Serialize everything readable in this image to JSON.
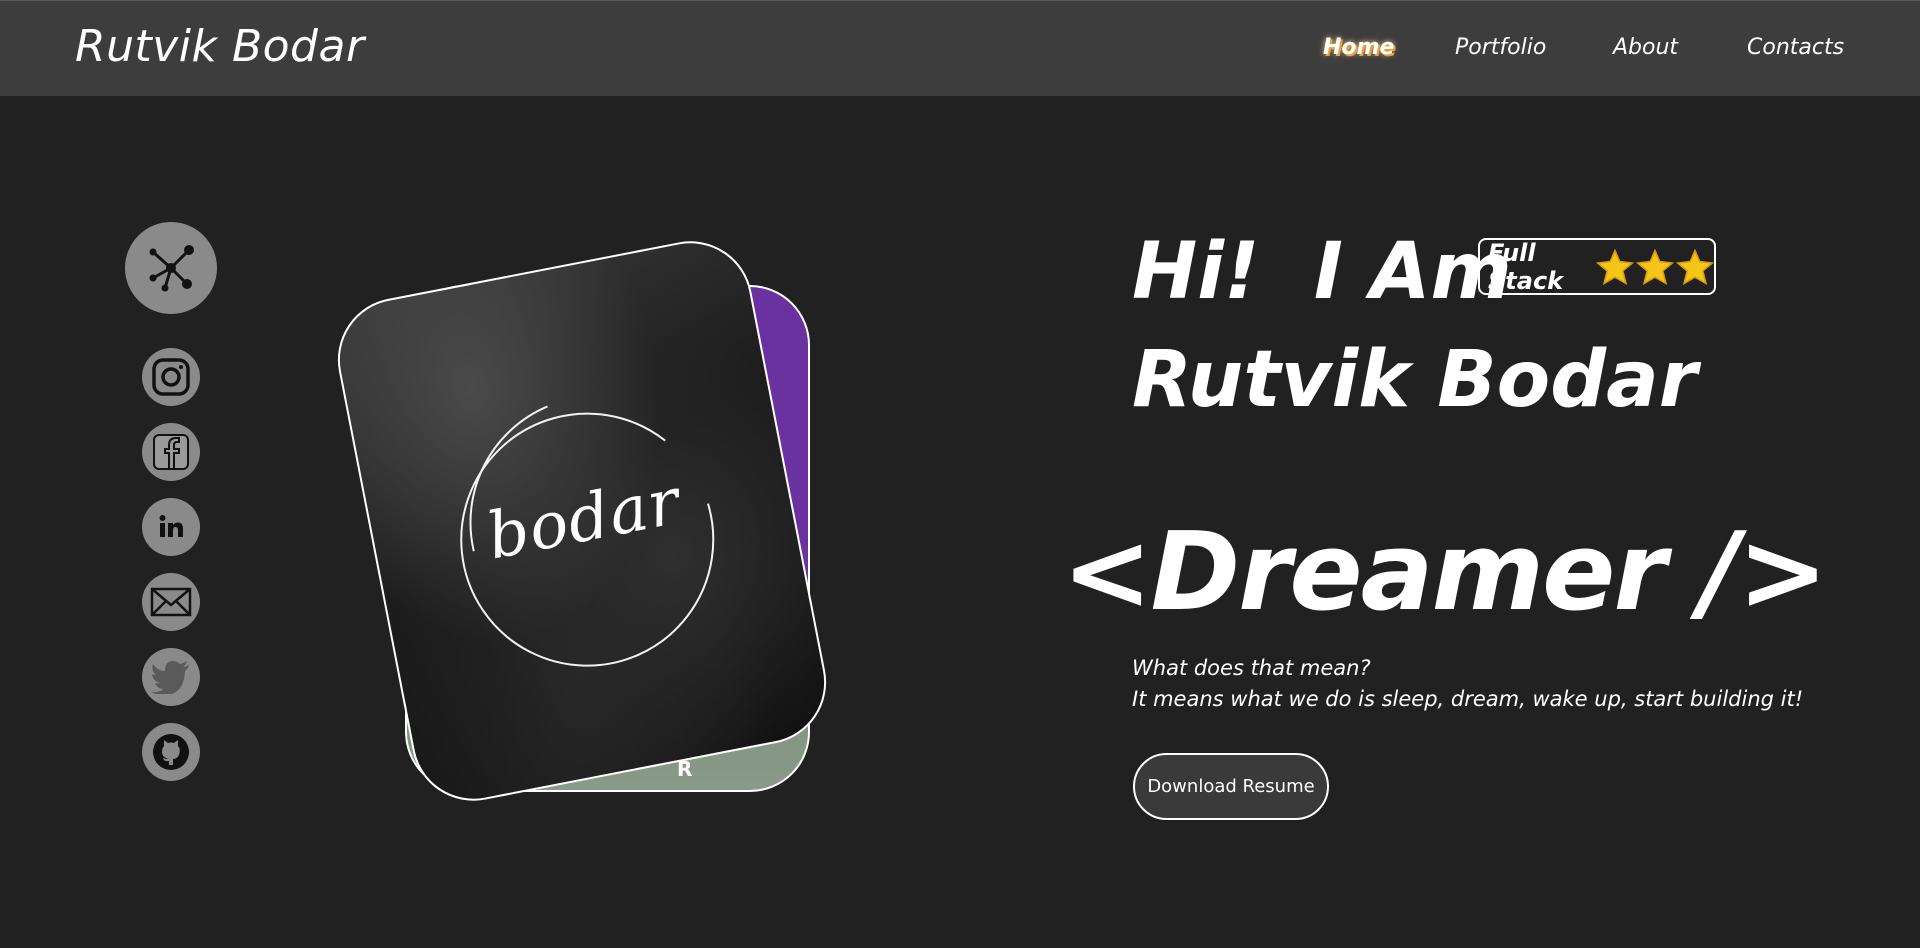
{
  "header": {
    "brand": "Rutvik Bodar",
    "nav": [
      {
        "label": "Home",
        "active": true
      },
      {
        "label": "Portfolio",
        "active": false
      },
      {
        "label": "About",
        "active": false
      },
      {
        "label": "Contacts",
        "active": false
      }
    ]
  },
  "sidebar": {
    "share_icon": "share-network-icon",
    "socials": [
      {
        "icon": "instagram-icon"
      },
      {
        "icon": "facebook-icon"
      },
      {
        "icon": "linkedin-icon"
      },
      {
        "icon": "mail-icon"
      },
      {
        "icon": "twitter-icon"
      },
      {
        "icon": "github-icon"
      }
    ]
  },
  "profile": {
    "logo_text": "bodar",
    "back_card_text": "R",
    "colors": {
      "card_back": "#6a32a0",
      "card_front": "#1c1c1c"
    }
  },
  "hero": {
    "greeting": "Hi!  I Am",
    "name": "Rutvik Bodar",
    "badge": {
      "label": "Full Stack",
      "stars": 3
    },
    "tagline": "<Dreamer />",
    "question": "What does that mean?",
    "answer": "It means what we do is sleep, dream, wake up, start building it!",
    "resume_button": "Download Resume"
  },
  "colors": {
    "background": "#212121",
    "navbar": "#3d3d3d",
    "icon_bg": "#8a8a8a",
    "star": "#f5c518"
  }
}
